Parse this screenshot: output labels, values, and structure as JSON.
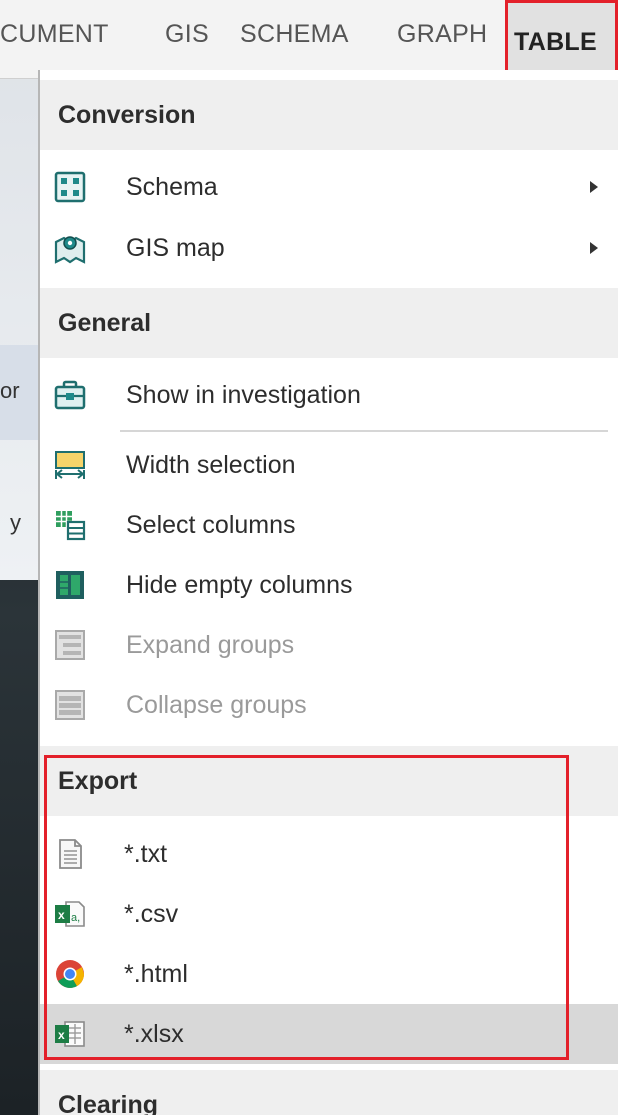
{
  "ribbon": {
    "tabs": [
      {
        "label": "CUMENT"
      },
      {
        "label": "GIS"
      },
      {
        "label": "SCHEMA"
      },
      {
        "label": "GRAPH"
      },
      {
        "label": "TABLE"
      }
    ]
  },
  "background_fragments": {
    "frag1": "or",
    "frag2": "y"
  },
  "menu": {
    "conversion": {
      "header": "Conversion",
      "items": [
        {
          "label": "Schema",
          "icon": "schema-icon"
        },
        {
          "label": "GIS map",
          "icon": "gis-map-icon"
        }
      ]
    },
    "general": {
      "header": "General",
      "items": [
        {
          "label": "Show in investigation",
          "icon": "briefcase-icon"
        },
        {
          "label": "Width selection",
          "icon": "width-selection-icon"
        },
        {
          "label": "Select columns",
          "icon": "select-columns-icon"
        },
        {
          "label": "Hide empty columns",
          "icon": "hide-empty-columns-icon"
        },
        {
          "label": "Expand groups",
          "icon": "expand-groups-icon",
          "disabled": true
        },
        {
          "label": "Collapse groups",
          "icon": "collapse-groups-icon",
          "disabled": true
        }
      ]
    },
    "export": {
      "header": "Export",
      "items": [
        {
          "label": "*.txt",
          "icon": "text-file-icon"
        },
        {
          "label": "*.csv",
          "icon": "csv-file-icon"
        },
        {
          "label": "*.html",
          "icon": "chrome-icon"
        },
        {
          "label": "*.xlsx",
          "icon": "excel-file-icon",
          "highlighted": true
        }
      ]
    },
    "clearing": {
      "header": "Clearing"
    }
  },
  "colors": {
    "highlight_border": "#e3202a",
    "header_bg": "#efefef",
    "hover_bg": "#d8d8d8",
    "icon_teal": "#1f8a8a",
    "excel_green": "#1d7d45"
  }
}
